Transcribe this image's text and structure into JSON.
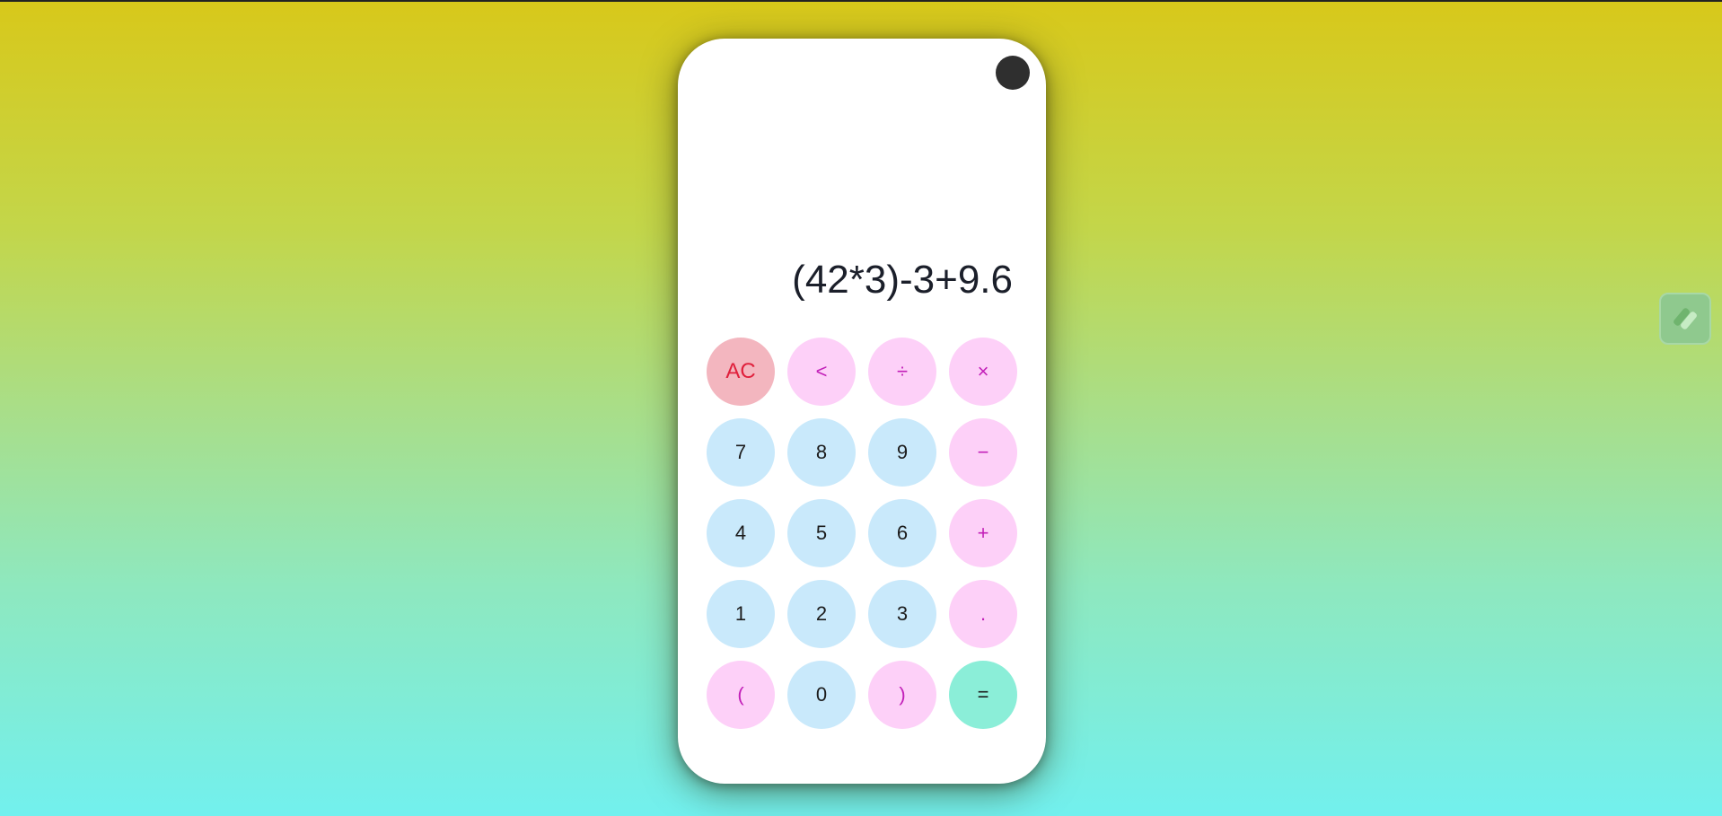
{
  "display": {
    "expression": "(42*3)-3+9.6"
  },
  "keys": {
    "ac": "AC",
    "backspace": "<",
    "divide": "÷",
    "multiply": "×",
    "seven": "7",
    "eight": "8",
    "nine": "9",
    "minus": "−",
    "four": "4",
    "five": "5",
    "six": "6",
    "plus": "+",
    "one": "1",
    "two": "2",
    "three": "3",
    "dot": ".",
    "open_paren": "(",
    "zero": "0",
    "close_paren": ")",
    "equals": "="
  },
  "colors": {
    "number_key": "#c9e9fb",
    "operator_key": "#fdd0f8",
    "clear_key": "#f3b6bf",
    "equals_key": "#8beed8",
    "operator_text": "#c21fb8",
    "clear_text": "#e0203c"
  },
  "icons": {
    "camera": "camera-dot-icon",
    "side_widget": "extension-icon"
  }
}
